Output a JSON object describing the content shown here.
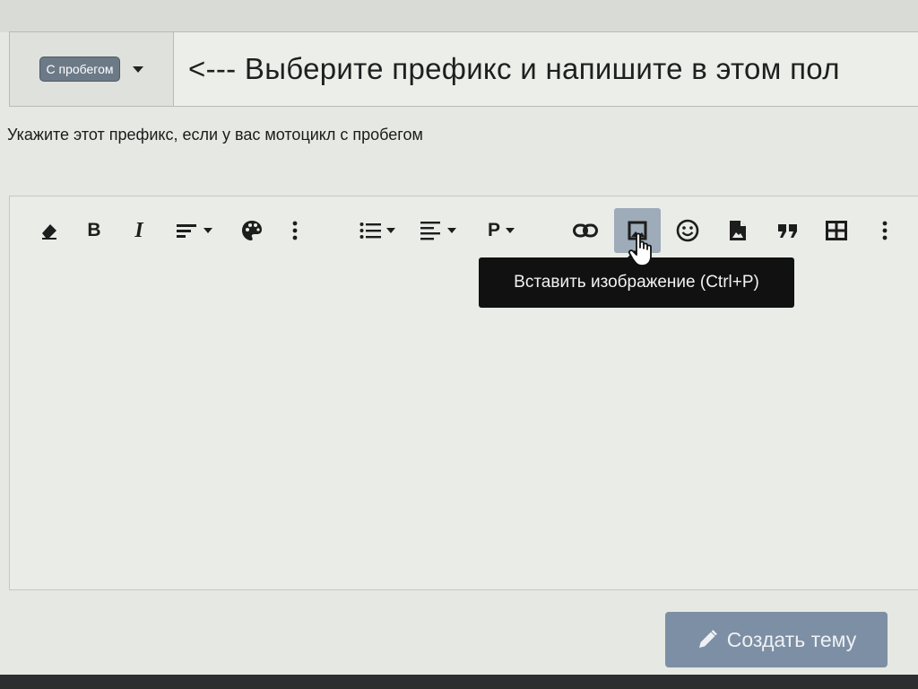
{
  "thread": {
    "prefix_label": "С пробегом",
    "title_value": "<--- Выберите префикс и напишите в этом пол",
    "prefix_hint": "Укажите этот префикс, если у вас мотоцикл с пробегом"
  },
  "toolbar": {
    "bold_label": "B",
    "italic_label": "I",
    "paragraph_label": "P",
    "tooltip": "Вставить изображение (Ctrl+P)",
    "icons": [
      "eraser-icon",
      "bold-icon",
      "italic-icon",
      "font-size-icon",
      "palette-icon",
      "more-vertical-icon",
      "list-icon",
      "align-icon",
      "paragraph-icon",
      "link-icon",
      "image-icon",
      "smile-icon",
      "media-icon",
      "quote-icon",
      "table-icon",
      "more-vertical-icon"
    ]
  },
  "actions": {
    "submit_label": "Создать тему"
  },
  "colors": {
    "prefix_badge": "#6c7a88",
    "active_button": "#9eabb9",
    "submit_button": "#7d8fa4",
    "tooltip_bg": "#111111"
  }
}
